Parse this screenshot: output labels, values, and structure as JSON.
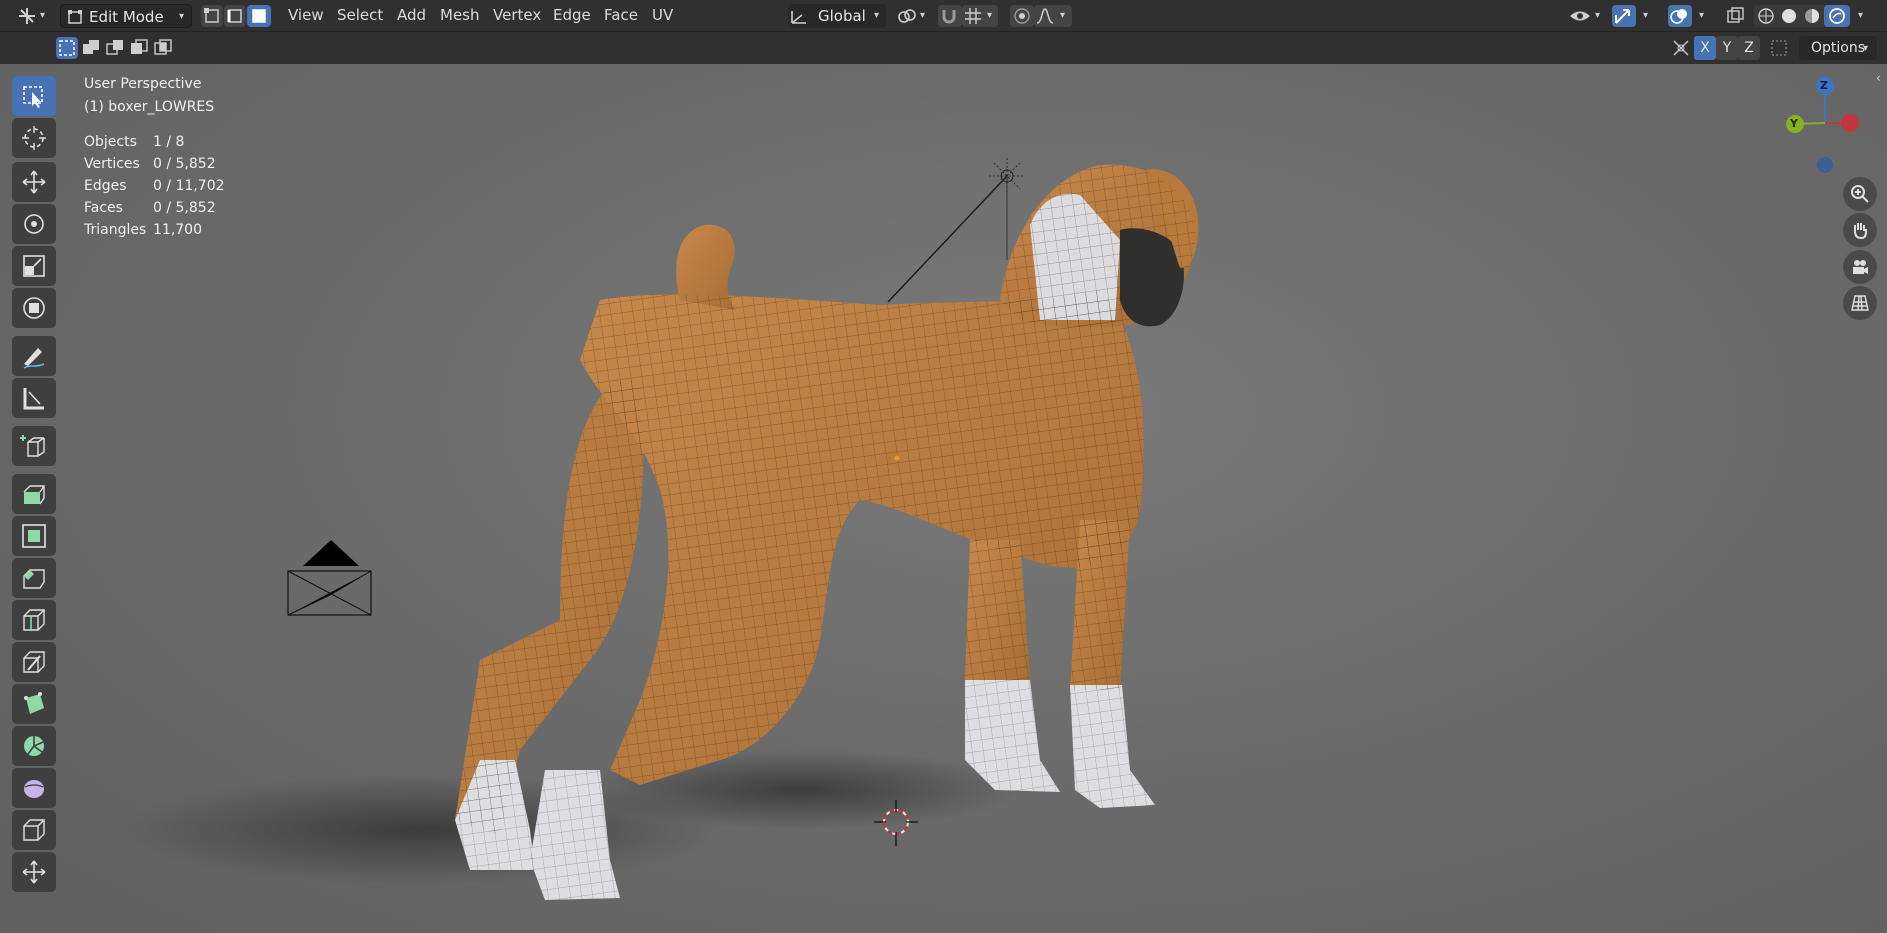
{
  "header": {
    "mode": "Edit Mode",
    "menus": [
      "View",
      "Select",
      "Add",
      "Mesh",
      "Vertex",
      "Edge",
      "Face",
      "UV"
    ],
    "transform_orientation": "Global",
    "icons": {
      "editor_type": "axis-cross-icon",
      "select_mode": [
        "vertex-select-icon",
        "edge-select-icon",
        "face-select-icon"
      ],
      "orientation": "transform-orientation-icon",
      "pivot": "pivot-link-icon",
      "snap": "magnet-icon",
      "snap_target": "snap-grid-icon",
      "proportional": "proportional-edit-icon",
      "falloff": "falloff-curve-icon",
      "visibility": "eye-visibility-icon",
      "gizmo": "gizmo-arrow-icon",
      "overlay": "overlay-circles-icon",
      "xray": "xray-icon",
      "shading": [
        "wireframe-shading-icon",
        "solid-shading-icon",
        "material-shading-icon",
        "rendered-shading-icon"
      ]
    }
  },
  "subheader": {
    "axes": [
      "X",
      "Y",
      "Z"
    ],
    "options_label": "Options"
  },
  "viewport": {
    "view_name": "User Perspective",
    "object_name": "(1) boxer_LOWRES",
    "stats": [
      {
        "label": "Objects",
        "value": "1 / 8"
      },
      {
        "label": "Vertices",
        "value": "0 / 5,852"
      },
      {
        "label": "Edges",
        "value": "0 / 11,702"
      },
      {
        "label": "Faces",
        "value": "0 / 5,852"
      },
      {
        "label": "Triangles",
        "value": "11,700"
      }
    ],
    "gizmo_axes": {
      "z": "Z",
      "y": "Y"
    }
  },
  "toolbar": {
    "tools": [
      "select-box-icon",
      "cursor-icon",
      "move-icon",
      "rotate-icon",
      "scale-icon",
      "transform-icon",
      "annotate-icon",
      "measure-icon",
      "add-cube-icon",
      "extrude-icon",
      "inset-icon",
      "bevel-icon",
      "loop-cut-icon",
      "knife-icon",
      "poly-build-icon",
      "spin-icon",
      "smooth-icon",
      "edge-slide-icon",
      "shrink-fatten-icon"
    ]
  },
  "colors": {
    "accent": "#4772b3",
    "header": "#303030",
    "fur_tan": "#b77c3e",
    "fur_white": "#dedee2",
    "axis_x": "#c2373f",
    "axis_y": "#85b020",
    "axis_z": "#3f73c3"
  }
}
